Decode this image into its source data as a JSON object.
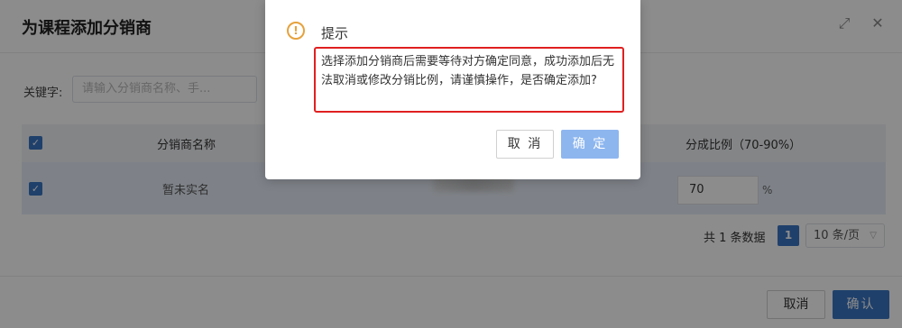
{
  "dialog": {
    "title": "为课程添加分销商",
    "fullscreen_icon": "expand-icon",
    "close_icon": "close-icon",
    "keyword_label": "关键字:",
    "keyword_placeholder": "请输入分销商名称、手...",
    "table": {
      "headers": [
        "分销商名称",
        "分成比例（70-90%）"
      ],
      "rows": [
        {
          "name": "暂未实名",
          "ratio": "70",
          "unit": "%"
        }
      ]
    },
    "pagination": {
      "total_text": "共 1 条数据",
      "current_page": "1",
      "page_size": "10 条/页"
    },
    "footer": {
      "cancel_label": "取消",
      "confirm_label": "确认"
    }
  },
  "messagebox": {
    "icon": "warning-icon",
    "title": "提示",
    "message": "选择添加分销商后需要等待对方确定同意，成功添加后无法取消或修改分销比例，请谨慎操作，是否确定添加?",
    "cancel_label": "取 消",
    "confirm_label": "确 定"
  },
  "colors": {
    "primary": "#3a75c4",
    "primary_light": "#8db6ef",
    "warning": "#e6a23c",
    "highlight_border": "#e02020"
  }
}
